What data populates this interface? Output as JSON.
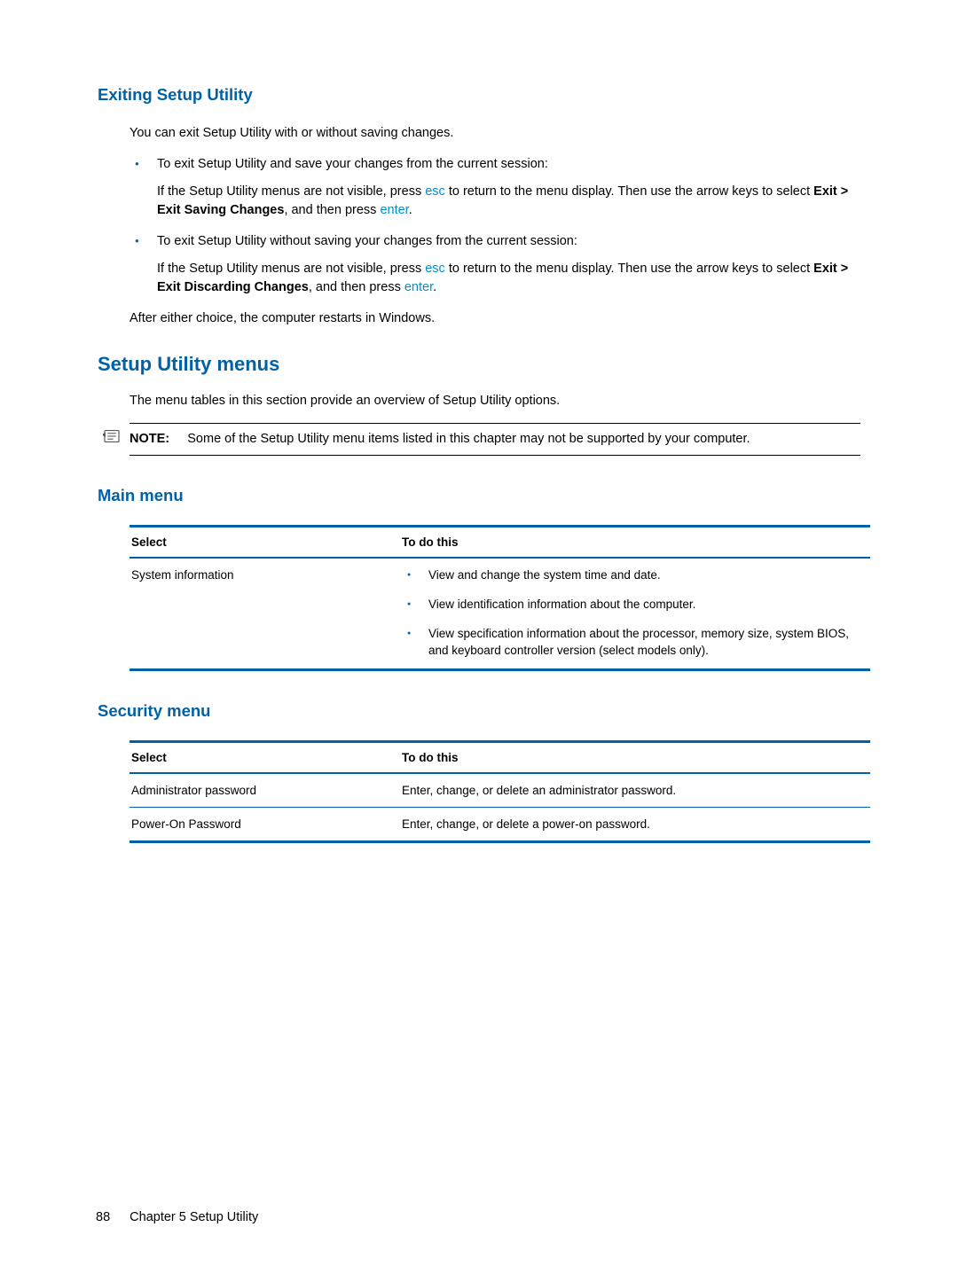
{
  "section1": {
    "heading": "Exiting Setup Utility",
    "intro": "You can exit Setup Utility with or without saving changes.",
    "bullet1_lead": "To exit Setup Utility and save your changes from the current session:",
    "bullet1_sub_pre": "If the Setup Utility menus are not visible, press ",
    "bullet1_sub_key1": "esc",
    "bullet1_sub_mid": " to return to the menu display. Then use the arrow keys to select ",
    "bullet1_sub_bold": "Exit > Exit Saving Changes",
    "bullet1_sub_after": ", and then press ",
    "bullet1_sub_key2": "enter",
    "bullet1_sub_end": ".",
    "bullet2_lead": "To exit Setup Utility without saving your changes from the current session:",
    "bullet2_sub_pre": "If the Setup Utility menus are not visible, press ",
    "bullet2_sub_key1": "esc",
    "bullet2_sub_mid": " to return to the menu display. Then use the arrow keys to select ",
    "bullet2_sub_bold": "Exit > Exit Discarding Changes",
    "bullet2_sub_after": ", and then press ",
    "bullet2_sub_key2": "enter",
    "bullet2_sub_end": ".",
    "after_choice": "After either choice, the computer restarts in Windows."
  },
  "section2": {
    "heading": "Setup Utility menus",
    "intro": "The menu tables in this section provide an overview of Setup Utility options.",
    "note_label": "NOTE:",
    "note_text": "Some of the Setup Utility menu items listed in this chapter may not be supported by your computer."
  },
  "main_menu": {
    "heading": "Main menu",
    "col1": "Select",
    "col2": "To do this",
    "row1_select": "System information",
    "row1_b1": "View and change the system time and date.",
    "row1_b2": "View identification information about the computer.",
    "row1_b3": "View specification information about the processor, memory size, system BIOS, and keyboard controller version (select models only)."
  },
  "security_menu": {
    "heading": "Security menu",
    "col1": "Select",
    "col2": "To do this",
    "row1_select": "Administrator password",
    "row1_do": "Enter, change, or delete an administrator password.",
    "row2_select": "Power-On Password",
    "row2_do": "Enter, change, or delete a power-on password."
  },
  "footer": {
    "page": "88",
    "chapter": "Chapter 5   Setup Utility"
  }
}
